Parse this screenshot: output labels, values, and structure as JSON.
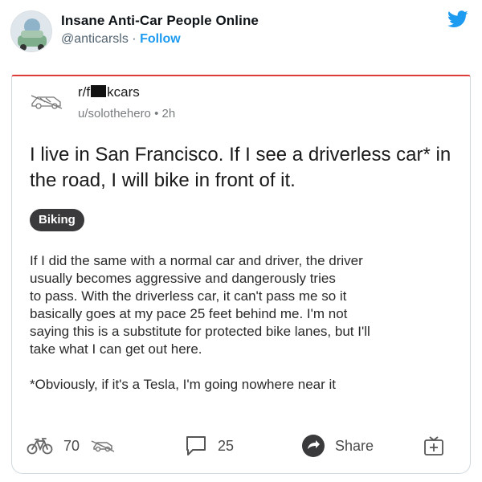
{
  "tweet": {
    "author_name": "Insane Anti-Car People Online",
    "author_handle": "@anticarsls",
    "separator": "·",
    "follow_label": "Follow"
  },
  "post": {
    "subreddit": {
      "prefix": "r/f",
      "suffix": "kcars"
    },
    "username": "u/solothehero",
    "meta_separator": "•",
    "age": "2h",
    "title": "I live in San Francisco. If I see a driverless car* in the road, I will bike in front of it.",
    "flair": "Biking",
    "body_paragraph_1": "If I did the same with a normal car and driver, the driver\nusually becomes aggressive and dangerously tries\nto pass. With the driverless car, it can't pass me so it\nbasically goes at my pace 25 feet behind me. I'm not\nsaying this is a substitute for protected bike lanes, but I'll\ntake what I can get out here.",
    "body_paragraph_2": "*Obviously, if it's a Tesla, I'm going nowhere near it"
  },
  "actions": {
    "upvote_count": "70",
    "comment_count": "25",
    "share_label": "Share"
  },
  "colors": {
    "twitter_blue": "#1d9bf0",
    "card_top_accent": "#e03b3b",
    "flair_bg": "#3a3a3c"
  },
  "icons": [
    "avatar",
    "twitter-bird-icon",
    "subreddit-icon",
    "bike-upvote-icon",
    "downvote-icon",
    "comment-icon",
    "share-icon",
    "award-icon"
  ]
}
